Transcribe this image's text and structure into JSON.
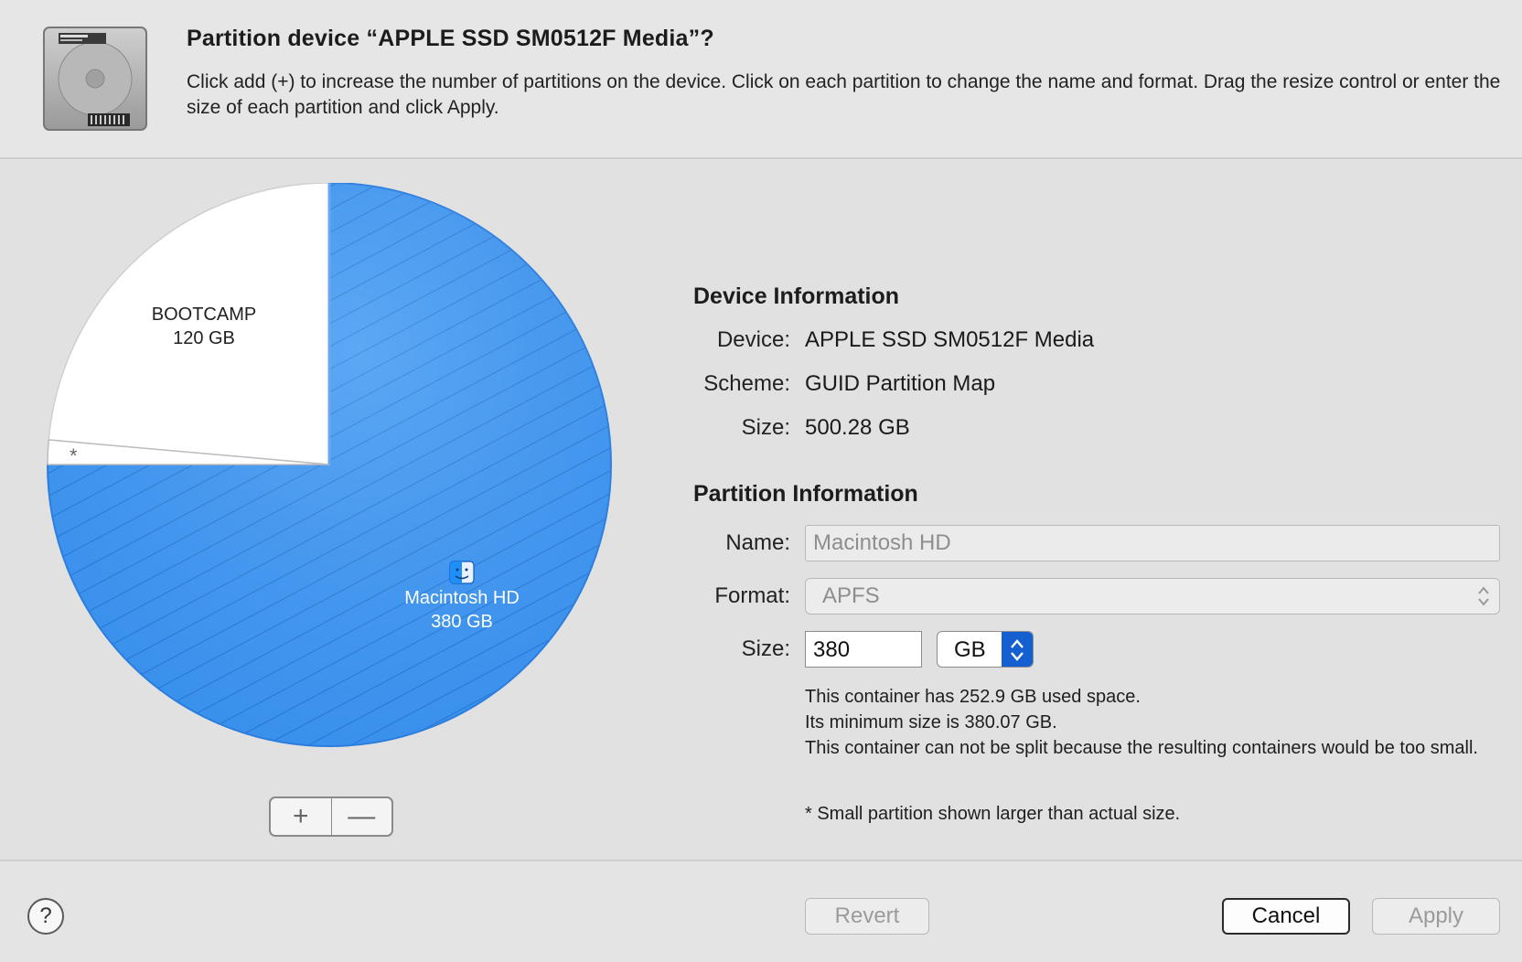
{
  "header": {
    "title": "Partition device “APPLE SSD SM0512F Media”?",
    "description": "Click add (+) to increase the number of partitions on the device. Click on each partition to change the name and format. Drag the resize control or enter the size of each partition and click Apply."
  },
  "pie": {
    "partitions": [
      {
        "name": "Macintosh HD",
        "size": "380 GB",
        "color": "#2b8cf0",
        "selected": true
      },
      {
        "name": "BOOTCAMP",
        "size": "120 GB",
        "color": "#ffffff"
      }
    ],
    "small_marker": "*"
  },
  "device_info": {
    "heading": "Device Information",
    "device_label": "Device:",
    "device_value": "APPLE SSD SM0512F Media",
    "scheme_label": "Scheme:",
    "scheme_value": "GUID Partition Map",
    "size_label": "Size:",
    "size_value": "500.28 GB"
  },
  "partition_info": {
    "heading": "Partition Information",
    "name_label": "Name:",
    "name_value": "Macintosh HD",
    "format_label": "Format:",
    "format_value": "APFS",
    "size_label": "Size:",
    "size_value": "380",
    "size_unit": "GB"
  },
  "notes": {
    "line1": "This container has 252.9 GB used space.",
    "line2": "Its minimum size is 380.07 GB.",
    "line3": "This container can not be split because the resulting containers would be too small.",
    "footnote": "* Small partition shown larger than actual size."
  },
  "buttons": {
    "add": "+",
    "remove": "—",
    "help": "?",
    "revert": "Revert",
    "cancel": "Cancel",
    "apply": "Apply"
  },
  "colors": {
    "accent": "#1560d0",
    "partition_blue": "#2b8cf0"
  }
}
